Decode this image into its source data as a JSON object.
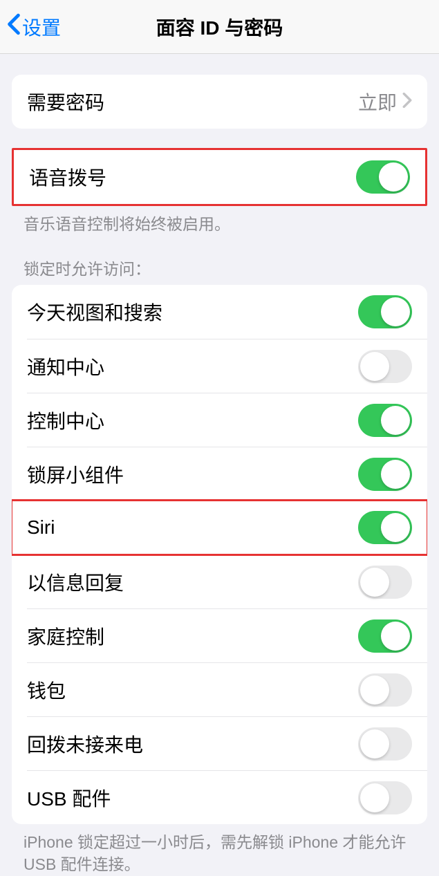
{
  "nav": {
    "back_label": "设置",
    "title": "面容 ID 与密码"
  },
  "passcode_group": {
    "require_passcode": {
      "label": "需要密码",
      "value": "立即"
    }
  },
  "voice_dial": {
    "label": "语音拨号",
    "on": true,
    "footer": "音乐语音控制将始终被启用。"
  },
  "allow_access": {
    "header": "锁定时允许访问：",
    "items": [
      {
        "label": "今天视图和搜索",
        "on": true
      },
      {
        "label": "通知中心",
        "on": false
      },
      {
        "label": "控制中心",
        "on": true
      },
      {
        "label": "锁屏小组件",
        "on": true
      },
      {
        "label": "Siri",
        "on": true
      },
      {
        "label": "以信息回复",
        "on": false
      },
      {
        "label": "家庭控制",
        "on": true
      },
      {
        "label": "钱包",
        "on": false
      },
      {
        "label": "回拨未接来电",
        "on": false
      },
      {
        "label": "USB 配件",
        "on": false
      }
    ],
    "footer": "iPhone 锁定超过一小时后，需先解锁 iPhone 才能允许USB 配件连接。"
  },
  "highlighted_rows": [
    0,
    5
  ]
}
